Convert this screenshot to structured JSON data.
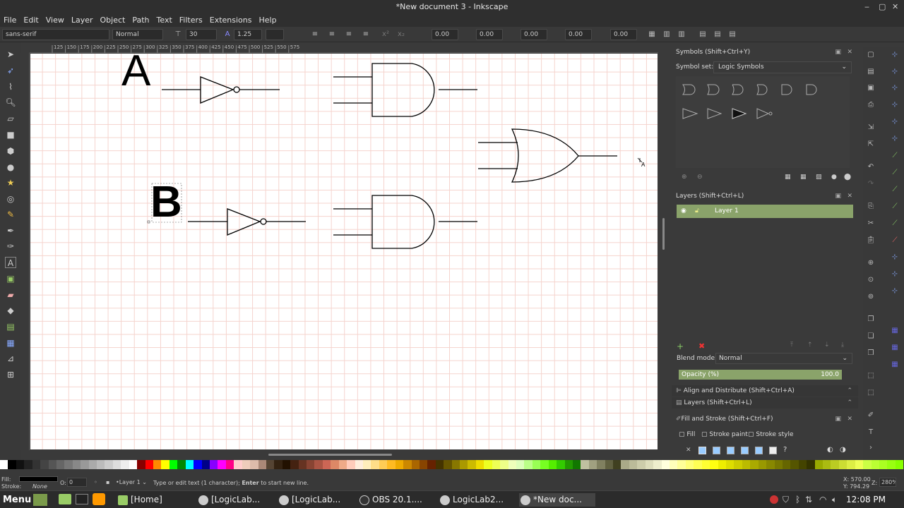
{
  "window": {
    "title": "*New document 3 - Inkscape",
    "minimize": "‒",
    "maximize": "▢",
    "close": "✕"
  },
  "menu": [
    "File",
    "Edit",
    "View",
    "Layer",
    "Object",
    "Path",
    "Text",
    "Filters",
    "Extensions",
    "Help"
  ],
  "text_toolbar": {
    "font_family": "sans-serif",
    "font_style": "Normal",
    "font_size": "30",
    "line_spacing": "1.25",
    "kern_x": "0.00",
    "kern_y": "0.00",
    "letter_spacing": "0.00",
    "word_spacing": "0.00",
    "rotation": "0.00"
  },
  "ruler_labels": [
    "125",
    "150",
    "175",
    "200",
    "225",
    "250",
    "275",
    "300",
    "325",
    "350",
    "375",
    "400",
    "425",
    "450",
    "475",
    "500",
    "525",
    "550",
    "575"
  ],
  "canvas_text": {
    "a": "A",
    "b": "B"
  },
  "symbols_panel": {
    "title": "Symbols (Shift+Ctrl+Y)",
    "symbol_set_label": "Symbol set:",
    "symbol_set_value": "Logic Symbols"
  },
  "layers_panel": {
    "title": "Layers (Shift+Ctrl+L)",
    "layers": [
      {
        "name": "Layer 1"
      }
    ],
    "blend_label": "Blend mode:",
    "blend_value": "Normal",
    "opacity_label": "Opacity (%)",
    "opacity_value": "100.0"
  },
  "collapsed_panels": [
    "Align and Distribute (Shift+Ctrl+A)",
    "Layers (Shift+Ctrl+L)"
  ],
  "fill_stroke": {
    "title": "Fill and Stroke (Shift+Ctrl+F)",
    "tabs": [
      "Fill",
      "Stroke paint",
      "Stroke style"
    ]
  },
  "status": {
    "fill_label": "Fill:",
    "stroke_label": "Stroke:",
    "stroke_value": "None",
    "opacity_label": "O:",
    "opacity_value": "0",
    "layer": "•Layer 1",
    "message_pre": "Type or edit text (1 character); ",
    "message_key": "Enter",
    "message_post": " to start new line.",
    "cursor_x": "X: 570.00",
    "cursor_y": "Y: 794.29",
    "zoom_label": "Z:",
    "zoom_value": "280%"
  },
  "taskbar": {
    "menu": "Menu",
    "tasks": [
      "[Home]",
      "[LogicLab...",
      "[LogicLab...",
      "OBS 20.1....",
      "LogicLab2...",
      "*New doc..."
    ],
    "clock": "12:08 PM"
  },
  "colors": {
    "accent_green": "#8aa36a",
    "canvas_bg": "#ffffff",
    "grid": "#f5d3cd"
  }
}
